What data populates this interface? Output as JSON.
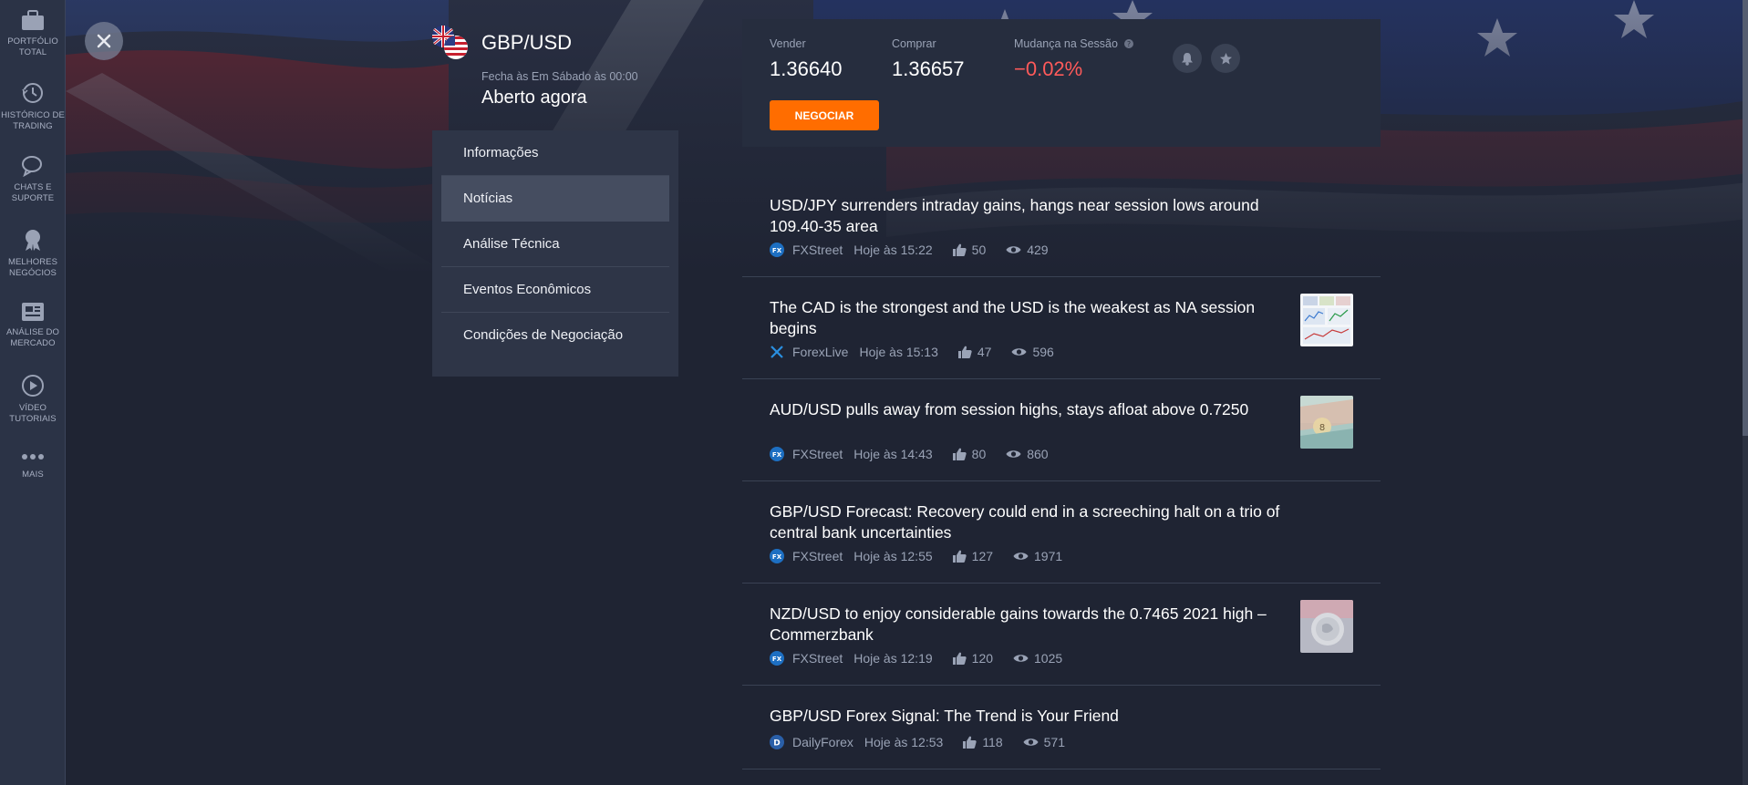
{
  "sidebar": {
    "items": [
      {
        "label": "PORTFÓLIO TOTAL",
        "icon": "briefcase-icon"
      },
      {
        "label": "HISTÓRICO DE TRADING",
        "icon": "history-icon"
      },
      {
        "label": "CHATS E SUPORTE",
        "icon": "chat-icon"
      },
      {
        "label": "MELHORES NEGÓCIOS",
        "icon": "award-icon"
      },
      {
        "label": "ANÁLISE DO MERCADO",
        "icon": "newspaper-icon"
      },
      {
        "label": "VÍDEO TUTORIAIS",
        "icon": "play-icon"
      },
      {
        "label": "MAIS",
        "icon": "more-icon"
      }
    ]
  },
  "instrument": {
    "symbol": "GBP/USD",
    "closing_info": "Fecha às Em Sábado às 00:00",
    "status": "Aberto agora"
  },
  "menu": {
    "items": [
      "Informações",
      "Notícias",
      "Análise Técnica",
      "Eventos Econômicos",
      "Condições de Negociação"
    ],
    "active": "Notícias"
  },
  "quote": {
    "sell_label": "Vender",
    "sell_value": "1.36640",
    "buy_label": "Comprar",
    "buy_value": "1.36657",
    "change_label": "Mudança na Sessão",
    "change_value": "−0.02%",
    "trade_button": "NEGOCIAR"
  },
  "news": [
    {
      "title": "USD/JPY surrenders intraday gains, hangs near session lows around 109.40-35 area",
      "source": "FXStreet",
      "time": "Hoje às 15:22",
      "likes": "50",
      "views": "429",
      "thumbnail": false
    },
    {
      "title": "The CAD is the strongest and the USD is the weakest as NA session begins",
      "source": "ForexLive",
      "time": "Hoje às 15:13",
      "likes": "47",
      "views": "596",
      "thumbnail": true
    },
    {
      "title": "AUD/USD pulls away from session highs, stays afloat above 0.7250",
      "source": "FXStreet",
      "time": "Hoje às 14:43",
      "likes": "80",
      "views": "860",
      "thumbnail": true
    },
    {
      "title": "GBP/USD Forecast: Recovery could end in a screeching halt on a trio of central bank uncertainties",
      "source": "FXStreet",
      "time": "Hoje às 12:55",
      "likes": "127",
      "views": "1971",
      "thumbnail": false
    },
    {
      "title": "NZD/USD to enjoy considerable gains towards the 0.7465 2021 high – Commerzbank",
      "source": "FXStreet",
      "time": "Hoje às 12:19",
      "likes": "120",
      "views": "1025",
      "thumbnail": true
    },
    {
      "title": "GBP/USD Forex Signal: The Trend is Your Friend",
      "source": "DailyForex",
      "time": "Hoje às 12:53",
      "likes": "118",
      "views": "571",
      "thumbnail": false
    }
  ],
  "colors": {
    "accent": "#ff6d00",
    "negative": "#ff5a5a",
    "background": "#1f2433",
    "panel": "#262d3e"
  }
}
